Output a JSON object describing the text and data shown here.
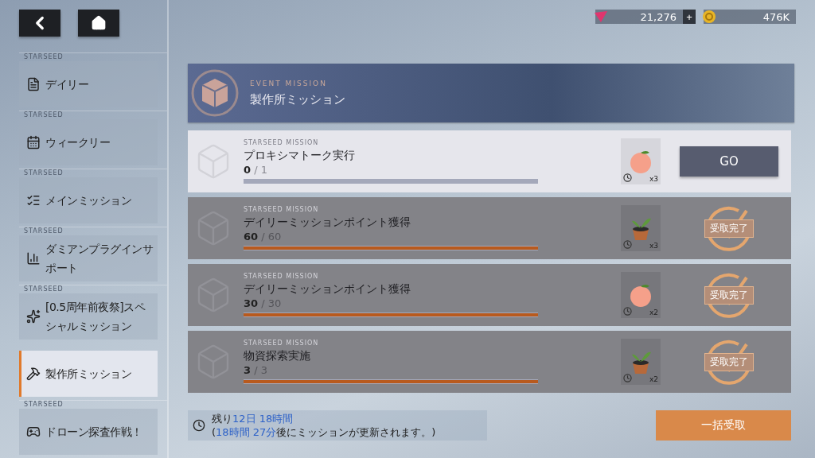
{
  "currencies": [
    {
      "kind": "gem",
      "value": "21,276",
      "plus": "+"
    },
    {
      "kind": "coin",
      "value": "476K"
    }
  ],
  "sidebar": {
    "items": [
      {
        "kind": "document",
        "tag": "STARSEED",
        "label": "デイリー",
        "selected": false
      },
      {
        "kind": "calendar",
        "tag": "STARSEED",
        "label": "ウィークリー",
        "selected": false
      },
      {
        "kind": "list",
        "tag": "STARSEED",
        "label": "メインミッション",
        "selected": false
      },
      {
        "kind": "chart",
        "tag": "STARSEED",
        "label": "ダミアンプラグインサポート",
        "selected": false
      },
      {
        "kind": "sparkle",
        "tag": "STARSEED",
        "label": "[0.5周年前夜祭]スペシャルミッション",
        "selected": false
      },
      {
        "kind": "tools",
        "label": "製作所ミッション",
        "selected": true
      },
      {
        "kind": "gamepad",
        "tag": "STARSEED",
        "label": "ドローン探査作戦！",
        "selected": false
      }
    ]
  },
  "header": {
    "subtitle": "EVENT MISSION",
    "title": "製作所ミッション"
  },
  "missions": [
    {
      "tag": "STARSEED MISSION",
      "title": "プロキシマトーク実行",
      "current": "0",
      "total": "/ 1",
      "level": 0,
      "reward": {
        "kind": "peach",
        "count": "x3"
      },
      "completed": false,
      "action": "GO"
    },
    {
      "tag": "STARSEED MISSION",
      "title": "デイリーミッションポイント獲得",
      "current": "60",
      "total": "/ 60",
      "level": 1,
      "reward": {
        "kind": "sprout",
        "count": "x3"
      },
      "completed": true,
      "action": "受取完了"
    },
    {
      "tag": "STARSEED MISSION",
      "title": "デイリーミッションポイント獲得",
      "current": "30",
      "total": "/ 30",
      "level": 1,
      "reward": {
        "kind": "peach",
        "count": "x2"
      },
      "completed": true,
      "action": "受取完了"
    },
    {
      "tag": "STARSEED MISSION",
      "title": "物資探索実施",
      "current": "3",
      "total": "/ 3",
      "level": 1,
      "reward": {
        "kind": "sprout",
        "count": "x2"
      },
      "completed": true,
      "action": "受取完了"
    }
  ],
  "footer": {
    "lines": [
      [
        {
          "text": "残り",
          "highlight": false
        },
        {
          "text": "12日 18時間",
          "highlight": true
        }
      ],
      [
        {
          "text": "(",
          "highlight": false
        },
        {
          "text": "18時間 27分",
          "highlight": true
        },
        {
          "text": "後にミッションが更新されます。)",
          "highlight": false
        }
      ]
    ],
    "claim_all": "一括受取"
  }
}
